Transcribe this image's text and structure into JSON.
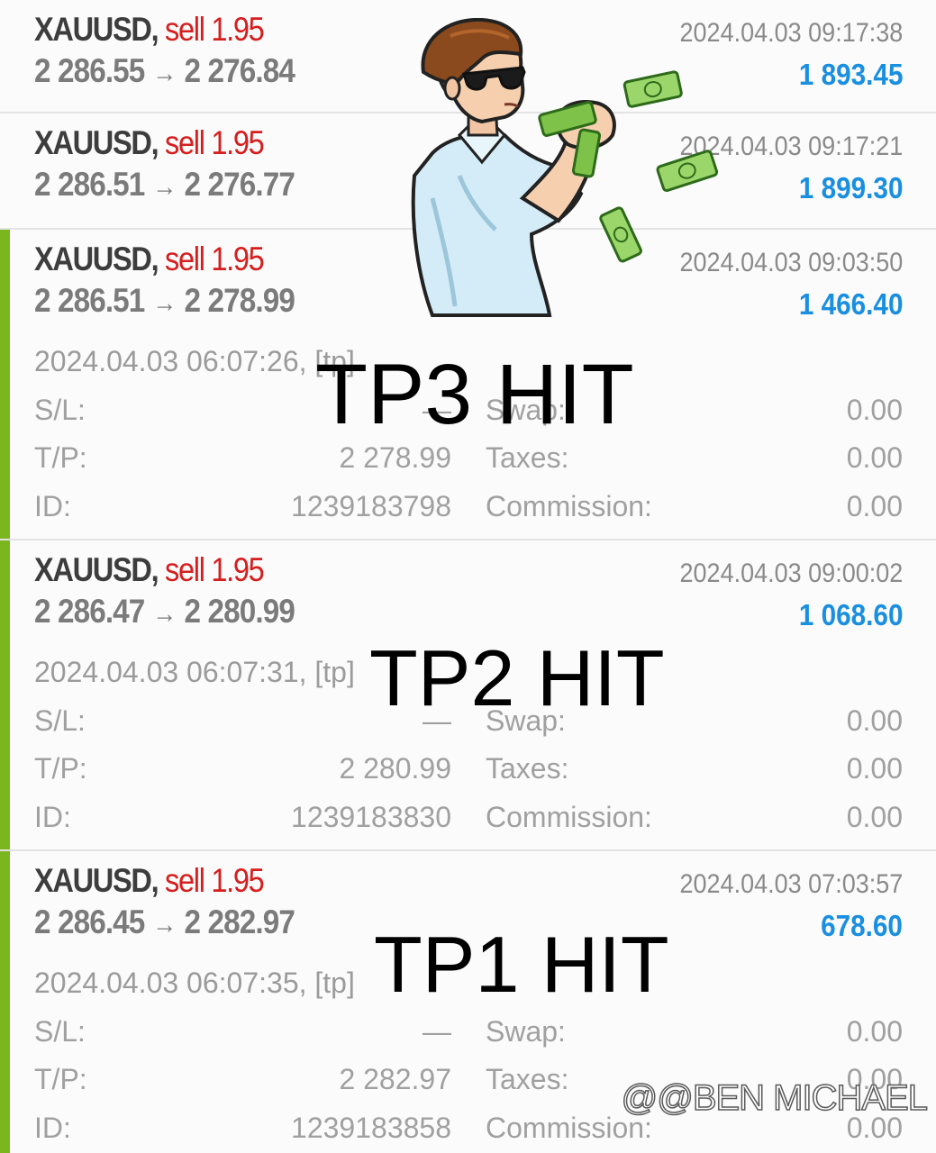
{
  "trades": [
    {
      "symbol": "XAUUSD,",
      "side": "sell",
      "volume": "1.95",
      "open_price": "2 286.55",
      "arrow": "→",
      "close_price": "2 276.84",
      "close_time": "2024.04.03 09:17:38",
      "profit": "1 893.45"
    },
    {
      "symbol": "XAUUSD,",
      "side": "sell",
      "volume": "1.95",
      "open_price": "2 286.51",
      "arrow": "→",
      "close_price": "2 276.77",
      "close_time": "2024.04.03 09:17:21",
      "profit": "1 899.30"
    },
    {
      "symbol": "XAUUSD,",
      "side": "sell",
      "volume": "1.95",
      "open_price": "2 286.51",
      "arrow": "→",
      "close_price": "2 278.99",
      "close_time": "2024.04.03 09:03:50",
      "profit": "1 466.40",
      "open_time": "2024.04.03 06:07:26, [tp]",
      "sl_label": "S/L:",
      "sl_value": "—",
      "tp_label": "T/P:",
      "tp_value": "2 278.99",
      "id_label": "ID:",
      "id_value": "1239183798",
      "swap_label": "Swap:",
      "swap_value": "0.00",
      "taxes_label": "Taxes:",
      "taxes_value": "0.00",
      "commission_label": "Commission:",
      "commission_value": "0.00",
      "overlay": "TP3 HIT"
    },
    {
      "symbol": "XAUUSD,",
      "side": "sell",
      "volume": "1.95",
      "open_price": "2 286.47",
      "arrow": "→",
      "close_price": "2 280.99",
      "close_time": "2024.04.03 09:00:02",
      "profit": "1 068.60",
      "open_time": "2024.04.03 06:07:31, [tp]",
      "sl_label": "S/L:",
      "sl_value": "—",
      "tp_label": "T/P:",
      "tp_value": "2 280.99",
      "id_label": "ID:",
      "id_value": "1239183830",
      "swap_label": "Swap:",
      "swap_value": "0.00",
      "taxes_label": "Taxes:",
      "taxes_value": "0.00",
      "commission_label": "Commission:",
      "commission_value": "0.00",
      "overlay": "TP2 HIT"
    },
    {
      "symbol": "XAUUSD,",
      "side": "sell",
      "volume": "1.95",
      "open_price": "2 286.45",
      "arrow": "→",
      "close_price": "2 282.97",
      "close_time": "2024.04.03 07:03:57",
      "profit": "678.60",
      "open_time": "2024.04.03 06:07:35, [tp]",
      "sl_label": "S/L:",
      "sl_value": "—",
      "tp_label": "T/P:",
      "tp_value": "2 282.97",
      "id_label": "ID:",
      "id_value": "1239183858",
      "swap_label": "Swap:",
      "swap_value": "0.00",
      "taxes_label": "Taxes:",
      "taxes_value": "0.00",
      "commission_label": "Commission:",
      "commission_value": "0.00",
      "overlay": "TP1 HIT"
    }
  ],
  "watermark": "@BEN MICHAEL",
  "colors": {
    "sell": "#d61e1e",
    "profit": "#1a8fe0",
    "accent_bar": "#7cb61e"
  },
  "icons": {
    "sticker": "cartoon-man-throwing-money",
    "watermark_logo": "threads-logo-icon"
  }
}
